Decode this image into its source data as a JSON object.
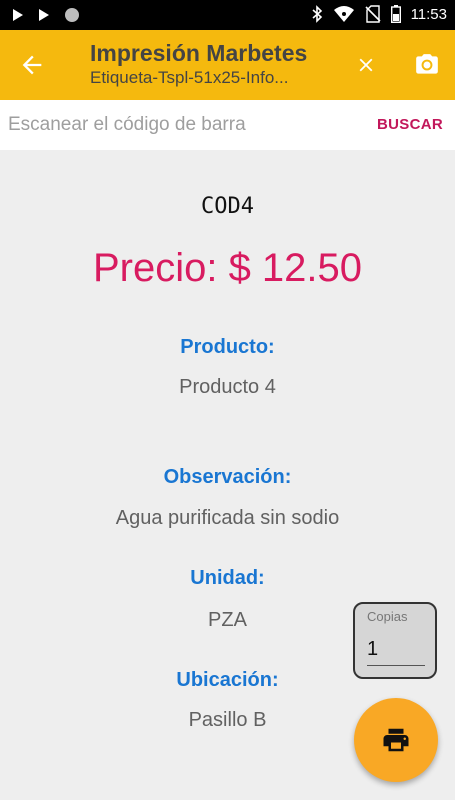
{
  "status_bar": {
    "time": "11:53",
    "icons_left": [
      "play-icon",
      "play-icon",
      "circle-icon"
    ],
    "icons_right": [
      "bluetooth-icon",
      "wifi-icon",
      "no-sim-icon",
      "battery-icon"
    ]
  },
  "app_bar": {
    "title": "Impresión Marbetes",
    "subtitle": "Etiqueta-Tspl-51x25-Info...",
    "background": "#f5b90e"
  },
  "search": {
    "placeholder": "Escanear el código de barra",
    "value": "",
    "button_label": "BUSCAR",
    "button_color": "#c2185b"
  },
  "product": {
    "code": "COD4",
    "price": "Precio: $ 12.50",
    "price_color": "#d81b60",
    "fields": [
      {
        "label": "Producto:",
        "value": "Producto 4"
      },
      {
        "label": "Observación:",
        "value": "Agua purificada sin sodio"
      },
      {
        "label": "Unidad:",
        "value": "PZA"
      },
      {
        "label": "Ubicación:",
        "value": "Pasillo B"
      }
    ],
    "label_color": "#1976d2"
  },
  "copies": {
    "label": "Copias",
    "value": "1"
  },
  "fab": {
    "icon": "printer-icon",
    "color": "#f9a825"
  }
}
